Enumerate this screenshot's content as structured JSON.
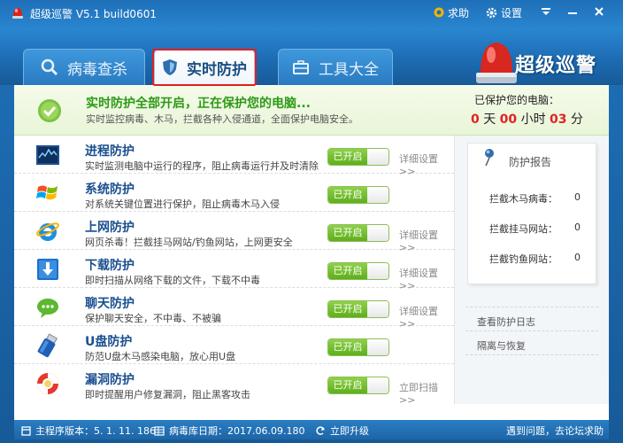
{
  "app": {
    "title": "超级巡警 V5.1 build0601",
    "help_label": "求助",
    "settings_label": "设置",
    "brand_text": "超级巡警"
  },
  "tabs": [
    {
      "label": "病毒查杀",
      "icon": "search-icon"
    },
    {
      "label": "实时防护",
      "icon": "shield-icon",
      "active": true
    },
    {
      "label": "工具大全",
      "icon": "toolbox-icon"
    }
  ],
  "status": {
    "title": "实时防护全部开启，正在保护您的电脑...",
    "subtitle": "实时监控病毒、木马，拦截各种入侵通道，全面保护电脑安全。",
    "guard_label": "已保护您的电脑：",
    "days": "0",
    "day_unit": "天",
    "hours": "00",
    "hour_unit": "小时",
    "minutes": "03",
    "minute_unit": "分"
  },
  "protections": [
    {
      "name": "进程防护",
      "desc": "实时监测电脑中运行的程序，阻止病毒运行并及时清除",
      "state": "已开启",
      "detail": "详细设置>>",
      "icon": "process-monitor-icon"
    },
    {
      "name": "系统防护",
      "desc": "对系统关键位置进行保护，阻止病毒木马入侵",
      "state": "已开启",
      "detail": "",
      "icon": "windows-logo-icon"
    },
    {
      "name": "上网防护",
      "desc": "网页杀毒！拦截挂马网站/钓鱼网站，上网更安全",
      "state": "已开启",
      "detail": "详细设置>>",
      "icon": "ie-browser-icon"
    },
    {
      "name": "下载防护",
      "desc": "即时扫描从网络下载的文件，下载不中毒",
      "state": "已开启",
      "detail": "详细设置>>",
      "icon": "download-icon"
    },
    {
      "name": "聊天防护",
      "desc": "保护聊天安全，不中毒、不被骗",
      "state": "已开启",
      "detail": "详细设置>>",
      "icon": "chat-bubble-icon"
    },
    {
      "name": "U盘防护",
      "desc": "防范U盘木马感染电脑，放心用U盘",
      "state": "已开启",
      "detail": "",
      "icon": "usb-drive-icon"
    },
    {
      "name": "漏洞防护",
      "desc": "即时提醒用户修复漏洞，阻止黑客攻击",
      "state": "已开启",
      "detail": "立即扫描>>",
      "icon": "lifebuoy-icon"
    }
  ],
  "report": {
    "title": "防护报告",
    "items": [
      {
        "label": "拦截木马病毒：",
        "value": "0"
      },
      {
        "label": "拦截挂马网站：",
        "value": "0"
      },
      {
        "label": "拦截钓鱼网站：",
        "value": "0"
      }
    ],
    "links": [
      "查看防护日志",
      "隔离与恢复"
    ]
  },
  "footer": {
    "version": "主程序版本：5. 1. 11. 186",
    "db_date": "病毒库日期：2017.06.09.180",
    "upgrade": "立即升级",
    "help": "遇到问题，去论坛求助"
  }
}
